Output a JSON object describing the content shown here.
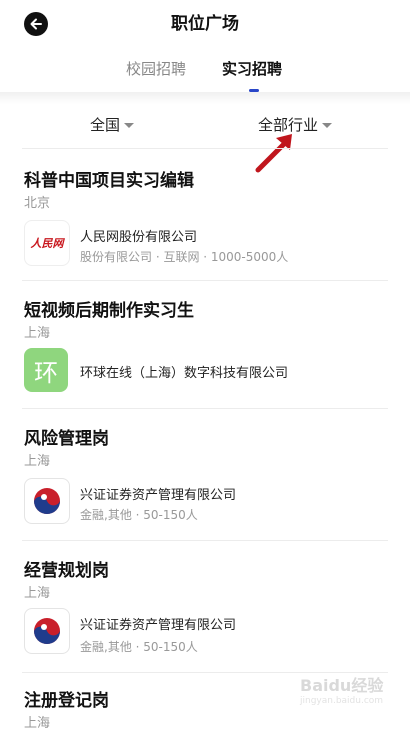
{
  "header": {
    "title": "职位广场",
    "back_icon": "back-arrow-icon"
  },
  "tabs": [
    {
      "label": "校园招聘",
      "active": false
    },
    {
      "label": "实习招聘",
      "active": true
    }
  ],
  "accent_color": "#2946c8",
  "filters": {
    "region": "全国",
    "industry": "全部行业"
  },
  "jobs": [
    {
      "title": "科普中国项目实习编辑",
      "location": "北京",
      "company": "人民网股份有限公司",
      "meta": "股份有限公司 · 互联网 · 1000-5000人",
      "logo": "people-daily-logo",
      "logo_text": "人民网"
    },
    {
      "title": "短视频后期制作实习生",
      "location": "上海",
      "company": "环球在线（上海）数字科技有限公司",
      "meta": "",
      "logo": "huan-logo",
      "logo_text": "环"
    },
    {
      "title": "风险管理岗",
      "location": "上海",
      "company": "兴证证券资产管理有限公司",
      "meta": "金融,其他 · 50-150人",
      "logo": "xingzheng-logo"
    },
    {
      "title": "经营规划岗",
      "location": "上海",
      "company": "兴证证券资产管理有限公司",
      "meta": "金融,其他 · 50-150人",
      "logo": "xingzheng-logo"
    },
    {
      "title": "注册登记岗",
      "location": "上海"
    }
  ],
  "watermark": {
    "text": "Baidu经验",
    "sub": "jingyan.baidu.com"
  }
}
